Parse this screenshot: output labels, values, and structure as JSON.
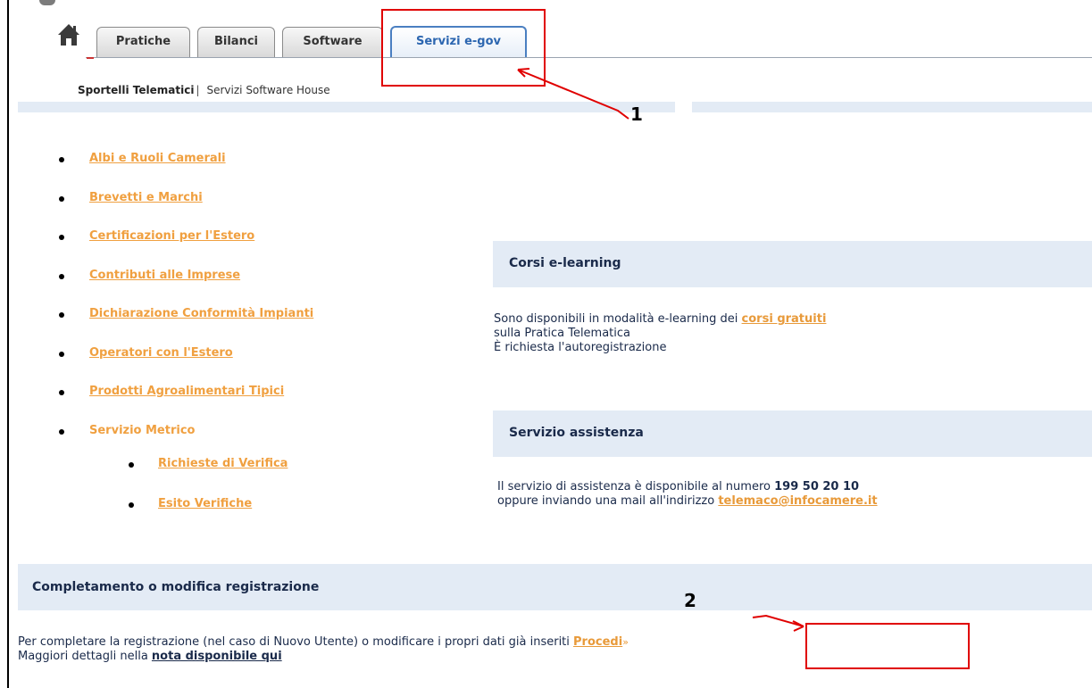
{
  "tabs": {
    "home_icon": "home-icon",
    "items": [
      {
        "label": "Pratiche"
      },
      {
        "label": "Bilanci"
      },
      {
        "label": "Software"
      },
      {
        "label": "Servizi e-gov"
      }
    ]
  },
  "subnav": {
    "current": "Sportelli Telematici",
    "separator": "|",
    "other": "Servizi Software House"
  },
  "services": [
    {
      "label": "Albi e Ruoli Camerali"
    },
    {
      "label": "Brevetti e Marchi"
    },
    {
      "label": "Certificazioni per l'Estero"
    },
    {
      "label": "Contributi alle Imprese"
    },
    {
      "label": "Dichiarazione Conformità Impianti"
    },
    {
      "label": "Operatori con l'Estero"
    },
    {
      "label": "Prodotti Agroalimentari Tipici"
    },
    {
      "label": "Servizio Metrico"
    }
  ],
  "metrico_sub": [
    {
      "label": "Richieste di Verifica"
    },
    {
      "label": "Esito Verifiche"
    }
  ],
  "elearning": {
    "title": "Corsi e-learning",
    "line1_pre": "Sono disponibili in modalità e-learning dei ",
    "line1_link": "corsi gratuiti",
    "line2": "sulla Pratica Telematica",
    "line3": "È richiesta l'autoregistrazione"
  },
  "assistenza": {
    "title": "Servizio assistenza",
    "line1_pre": "Il servizio di assistenza è disponibile al numero ",
    "phone": "199 50 20 10",
    "line2_pre": "oppure inviando una mail all'indirizzo ",
    "email": "telemaco@infocamere.it"
  },
  "registrazione": {
    "title": "Completamento o modifica registrazione",
    "line1_pre": "Per completare la registrazione (nel caso di Nuovo Utente) o modificare i propri dati già inseriti ",
    "procedi": "Procedi",
    "procedi_suffix": "»",
    "line2_pre": "Maggiori dettagli nella ",
    "line2_link": "nota disponibile qui"
  },
  "annotations": {
    "label1": "1",
    "label2": "2",
    "color": "#e00000"
  }
}
